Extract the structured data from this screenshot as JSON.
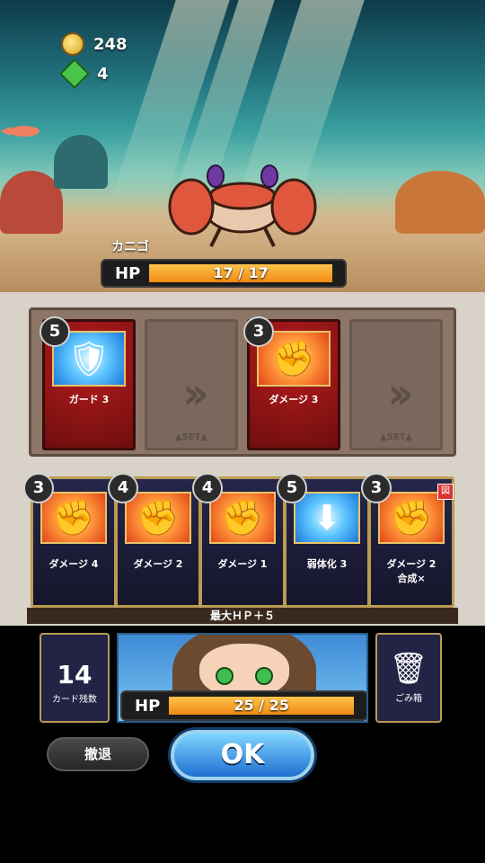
{
  "resources": {
    "coins": "248",
    "gems": "4"
  },
  "enemy": {
    "name": "カニゴ",
    "hp_label": "HP",
    "hp_text": "17 / 17",
    "hp_current": 17,
    "hp_max": 17
  },
  "set_slots": [
    {
      "type": "card",
      "cost": "5",
      "name": "ガード 3",
      "icon": "shield-icon"
    },
    {
      "type": "empty",
      "chevron": "››",
      "set_label": "▲SET▲"
    },
    {
      "type": "card",
      "cost": "3",
      "name": "ダメージ 3",
      "icon": "fist-icon"
    },
    {
      "type": "empty",
      "chevron": "››",
      "set_label": "▲SET▲"
    }
  ],
  "hand": [
    {
      "cost": "3",
      "name": "ダメージ 4",
      "icon": "fist-icon"
    },
    {
      "cost": "4",
      "name": "ダメージ 2",
      "icon": "fist-icon"
    },
    {
      "cost": "4",
      "name": "ダメージ 1",
      "icon": "fist-icon"
    },
    {
      "cost": "5",
      "name": "弱体化 3",
      "icon": "arrow-down-icon"
    },
    {
      "cost": "3",
      "name": "ダメージ 2",
      "sub": "合成×",
      "icon": "purple-fist-icon",
      "badge": "図"
    }
  ],
  "hand_strip": "最大ＨＰ＋５",
  "deck": {
    "count": "14",
    "label": "カード残数"
  },
  "player": {
    "hp_label": "HP",
    "hp_text": "25 / 25",
    "hp_current": 25,
    "hp_max": 25
  },
  "trash": {
    "label": "ごみ箱",
    "icon": "trash-icon"
  },
  "buttons": {
    "retreat": "撤退",
    "ok": "OK"
  }
}
